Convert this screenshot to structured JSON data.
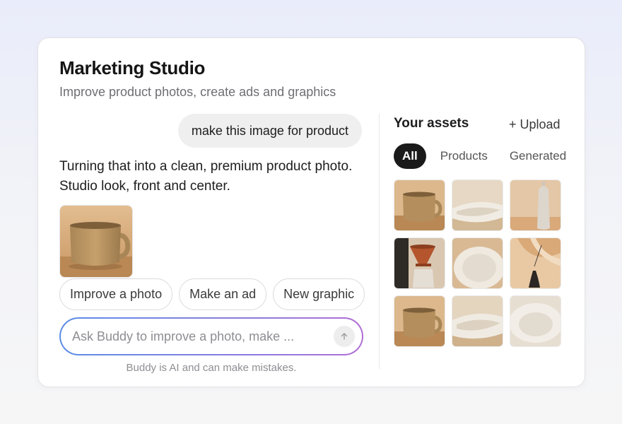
{
  "header": {
    "title": "Marketing Studio",
    "subtitle": "Improve product photos, create ads and graphics"
  },
  "chat": {
    "user_message": "make this image for product",
    "assistant_message": "Turning that into a clean, premium product photo. Studio look, front and center.",
    "result_image": "mug-photo",
    "chips": [
      "Improve a photo",
      "Make an ad",
      "New graphic"
    ],
    "input_value": "",
    "input_placeholder": "Ask Buddy to improve a photo, make ...",
    "send_icon": "arrow-up-icon",
    "disclaimer": "Buddy is AI and can make mistakes."
  },
  "assets": {
    "title": "Your assets",
    "upload_label": "+ Upload",
    "tabs": [
      {
        "label": "All",
        "active": true
      },
      {
        "label": "Products",
        "active": false
      },
      {
        "label": "Generated",
        "active": false
      }
    ],
    "items": [
      "mug",
      "bowl",
      "vase",
      "coffee-dripper",
      "plate",
      "bud-vase",
      "mug",
      "bowl",
      "plate"
    ]
  },
  "colors": {
    "accent_gradient_start": "#5b8de6",
    "accent_gradient_end": "#b06ed6",
    "active_tab": "#1a1a1a",
    "background": "#ffffff"
  }
}
